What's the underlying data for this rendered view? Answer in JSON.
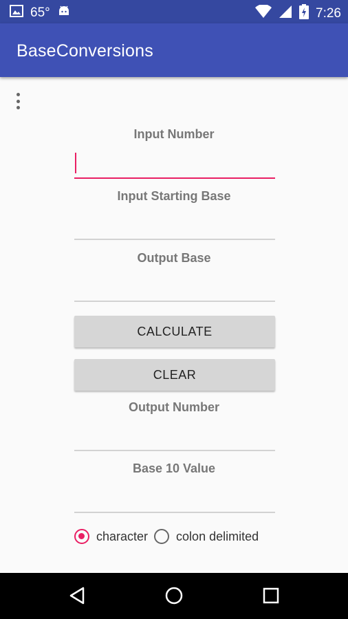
{
  "status_bar": {
    "temperature": "65°",
    "time": "7:26",
    "icons": [
      "gallery-icon",
      "android-icon",
      "wifi-icon",
      "signal-icon",
      "battery-icon"
    ]
  },
  "app_bar": {
    "title": "BaseConversions"
  },
  "form": {
    "input_number_label": "Input Number",
    "input_number_value": "",
    "input_starting_base_label": "Input Starting Base",
    "input_starting_base_value": "",
    "output_base_label": "Output Base",
    "output_base_value": "",
    "calculate_label": "CALCULATE",
    "clear_label": "CLEAR",
    "output_number_label": "Output Number",
    "output_number_value": "",
    "base10_label": "Base 10 Value",
    "base10_value": ""
  },
  "radio_options": {
    "character": "character",
    "colon_delimited": "colon delimited",
    "selected": "character"
  },
  "colors": {
    "primary": "#3f51b5",
    "primary_dark": "#3548a0",
    "accent": "#e91e63"
  },
  "nav_bar": {
    "icons": [
      "back-icon",
      "home-icon",
      "recents-icon"
    ]
  }
}
